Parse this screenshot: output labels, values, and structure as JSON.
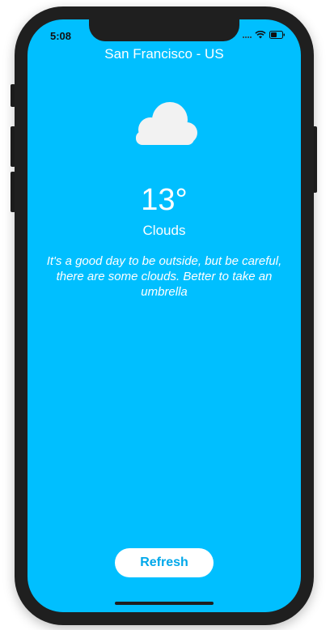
{
  "status_bar": {
    "time": "5:08"
  },
  "weather": {
    "city": "San Francisco - US",
    "temperature": "13°",
    "condition": "Clouds",
    "message": "It's a good day to be outside, but be careful, there are some clouds. Better to take an umbrella",
    "icon": "cloud-icon"
  },
  "actions": {
    "refresh_label": "Refresh"
  },
  "colors": {
    "background": "#00bfff",
    "button_text": "#00a8ea",
    "cloud": "#f2f2f2"
  }
}
